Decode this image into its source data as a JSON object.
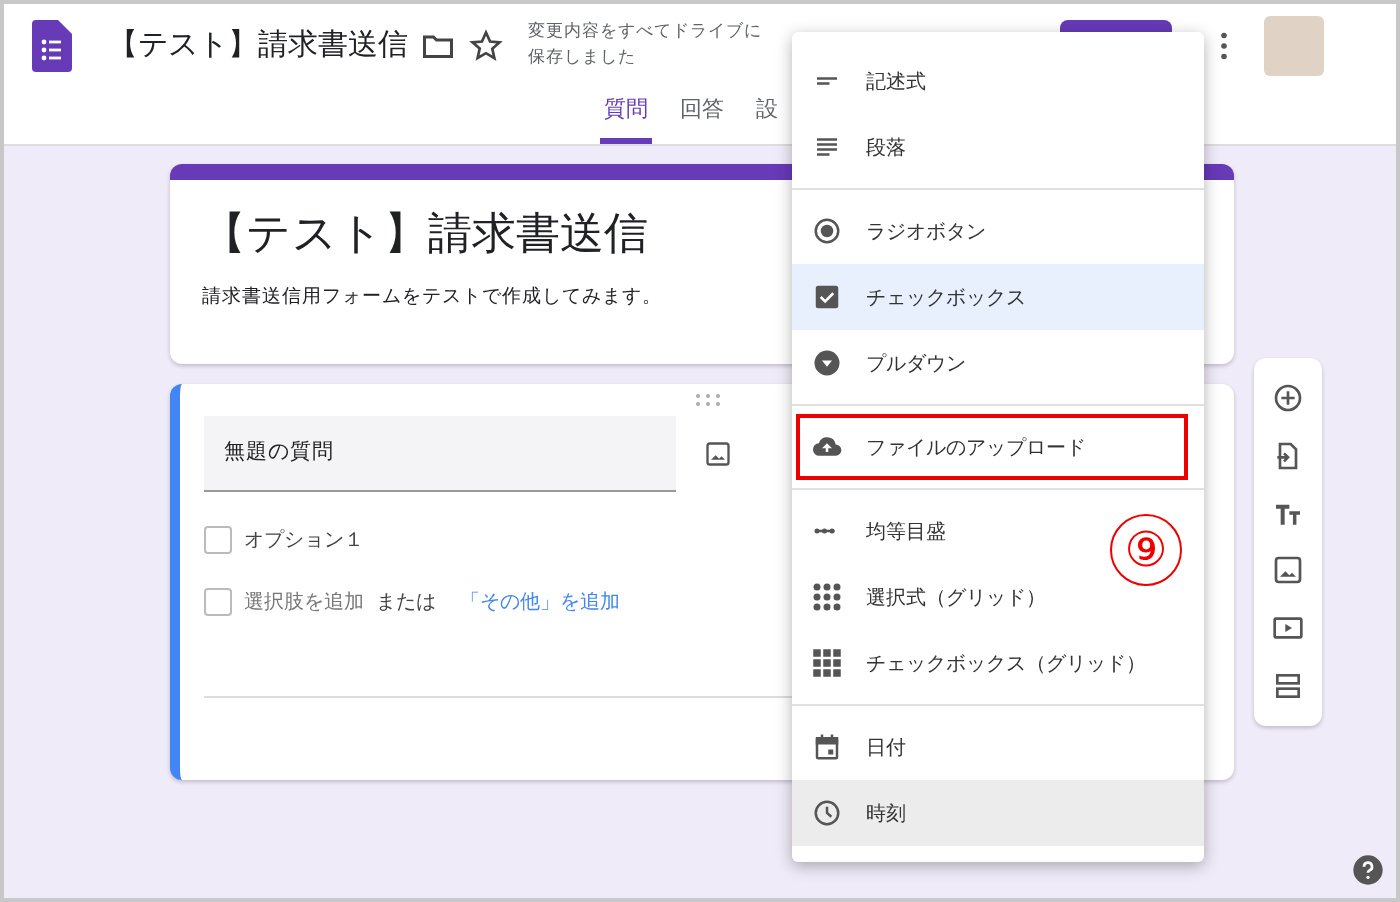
{
  "header": {
    "title": "【テスト】請求書送信",
    "save_status": [
      "変更内容をすべてドライブに",
      "保存しました"
    ]
  },
  "tabs": [
    {
      "label": "質問",
      "selected": true
    },
    {
      "label": "回答",
      "selected": false
    },
    {
      "label": "設",
      "selected": false
    }
  ],
  "form": {
    "title": "【テスト】請求書送信",
    "description": "請求書送信用フォームをテストで作成してみます。"
  },
  "question": {
    "title": "無題の質問",
    "options": [
      {
        "label": "オプション１",
        "checked": false
      }
    ],
    "add_checked": false,
    "add_option": "選択肢を追加",
    "or": "または",
    "add_other": "「その他」を追加"
  },
  "menu": {
    "groups": [
      [
        {
          "kind": "short",
          "label": "記述式",
          "selected": false,
          "hovered": false,
          "outlined": false
        },
        {
          "kind": "paragraph",
          "label": "段落",
          "selected": false,
          "hovered": false,
          "outlined": false
        }
      ],
      [
        {
          "kind": "radio",
          "label": "ラジオボタン",
          "selected": false,
          "hovered": false,
          "outlined": false
        },
        {
          "kind": "checkbox",
          "label": "チェックボックス",
          "selected": true,
          "hovered": false,
          "outlined": false
        },
        {
          "kind": "dropdown",
          "label": "プルダウン",
          "selected": false,
          "hovered": false,
          "outlined": false
        }
      ],
      [
        {
          "kind": "upload",
          "label": "ファイルのアップロード",
          "selected": false,
          "hovered": false,
          "outlined": true
        }
      ],
      [
        {
          "kind": "scale",
          "label": "均等目盛",
          "selected": false,
          "hovered": false,
          "outlined": false
        },
        {
          "kind": "grid",
          "label": "選択式（グリッド）",
          "selected": false,
          "hovered": false,
          "outlined": false
        },
        {
          "kind": "gridcheck",
          "label": "チェックボックス（グリッド）",
          "selected": false,
          "hovered": false,
          "outlined": false
        }
      ],
      [
        {
          "kind": "date",
          "label": "日付",
          "selected": false,
          "hovered": false,
          "outlined": false
        },
        {
          "kind": "time",
          "label": "時刻",
          "selected": false,
          "hovered": true,
          "outlined": false
        }
      ]
    ]
  },
  "callout": "⑨"
}
